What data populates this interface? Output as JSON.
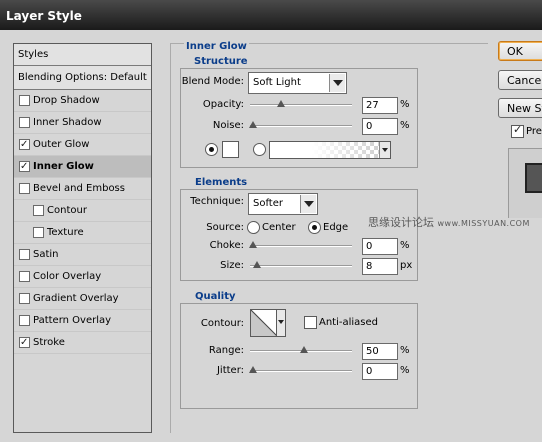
{
  "window": {
    "title": "Layer Style"
  },
  "styles_panel": {
    "header": "Styles",
    "blending_options": "Blending Options: Default",
    "items": [
      {
        "label": "Drop Shadow",
        "checked": false,
        "sub": false,
        "selected": false
      },
      {
        "label": "Inner Shadow",
        "checked": false,
        "sub": false,
        "selected": false
      },
      {
        "label": "Outer Glow",
        "checked": true,
        "sub": false,
        "selected": false
      },
      {
        "label": "Inner Glow",
        "checked": true,
        "sub": false,
        "selected": true
      },
      {
        "label": "Bevel and Emboss",
        "checked": false,
        "sub": false,
        "selected": false
      },
      {
        "label": "Contour",
        "checked": false,
        "sub": true,
        "selected": false
      },
      {
        "label": "Texture",
        "checked": false,
        "sub": true,
        "selected": false
      },
      {
        "label": "Satin",
        "checked": false,
        "sub": false,
        "selected": false
      },
      {
        "label": "Color Overlay",
        "checked": false,
        "sub": false,
        "selected": false
      },
      {
        "label": "Gradient Overlay",
        "checked": false,
        "sub": false,
        "selected": false
      },
      {
        "label": "Pattern Overlay",
        "checked": false,
        "sub": false,
        "selected": false
      },
      {
        "label": "Stroke",
        "checked": true,
        "sub": false,
        "selected": false
      }
    ]
  },
  "inner_glow": {
    "title": "Inner Glow",
    "structure": {
      "title": "Structure",
      "blend_mode_label": "Blend Mode:",
      "blend_mode_value": "Soft Light",
      "opacity_label": "Opacity:",
      "opacity_value": "27",
      "opacity_unit": "%",
      "opacity_fraction": 0.27,
      "noise_label": "Noise:",
      "noise_value": "0",
      "noise_unit": "%",
      "noise_fraction": 0.0,
      "color_mode": "solid",
      "color_swatch": "#ffffff"
    },
    "elements": {
      "title": "Elements",
      "technique_label": "Technique:",
      "technique_value": "Softer",
      "source_label": "Source:",
      "source_center": "Center",
      "source_edge": "Edge",
      "source_selected": "edge",
      "choke_label": "Choke:",
      "choke_value": "0",
      "choke_unit": "%",
      "choke_fraction": 0.0,
      "size_label": "Size:",
      "size_value": "8",
      "size_unit": "px",
      "size_fraction": 0.04
    },
    "quality": {
      "title": "Quality",
      "contour_label": "Contour:",
      "anti_aliased_label": "Anti-aliased",
      "anti_aliased_checked": false,
      "range_label": "Range:",
      "range_value": "50",
      "range_unit": "%",
      "range_fraction": 0.5,
      "jitter_label": "Jitter:",
      "jitter_value": "0",
      "jitter_unit": "%",
      "jitter_fraction": 0.0
    }
  },
  "buttons": {
    "ok": "OK",
    "cancel": "Cancel",
    "new_style": "New Style...",
    "preview_label": "Preview",
    "preview_checked": true
  },
  "watermark": {
    "text": "思缘设计论坛",
    "site": "www.MISSYUAN.COM"
  }
}
